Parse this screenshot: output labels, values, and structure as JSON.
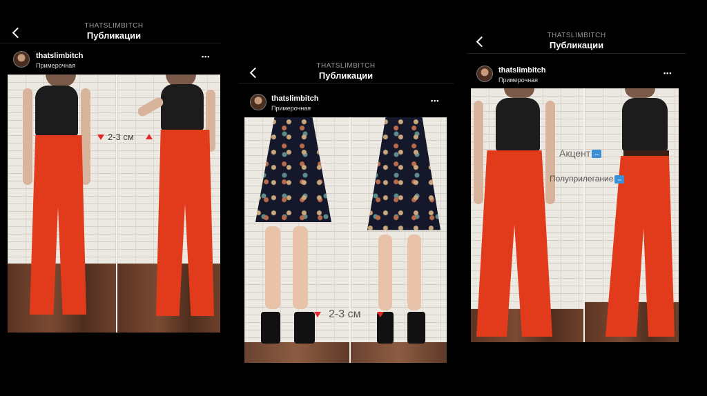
{
  "panels": [
    {
      "header_sub": "THATSLIMBITCH",
      "header_title": "Публикации",
      "username": "thatslimbitch",
      "location": "Примерочная",
      "annotation": "2-3 см"
    },
    {
      "header_sub": "THATSLIMBITCH",
      "header_title": "Публикации",
      "username": "thatslimbitch",
      "location": "Примерочная",
      "annotation": "2-3 см"
    },
    {
      "header_sub": "THATSLIMBITCH",
      "header_title": "Публикации",
      "username": "thatslimbitch",
      "location": "Примерочная",
      "annotation_1": "Акцент",
      "annotation_2": "Полуприлегание"
    }
  ],
  "more_glyph": "•••",
  "icons": [
    "chevron-left-icon",
    "avatar",
    "more-options-icon",
    "red-triangle-down-icon",
    "red-triangle-up-icon",
    "arrows-emoji-icon"
  ],
  "colors": {
    "background": "#000000",
    "trousers": "#e23b1c",
    "top": "#1c1c1c",
    "marker": "#e4262b"
  }
}
